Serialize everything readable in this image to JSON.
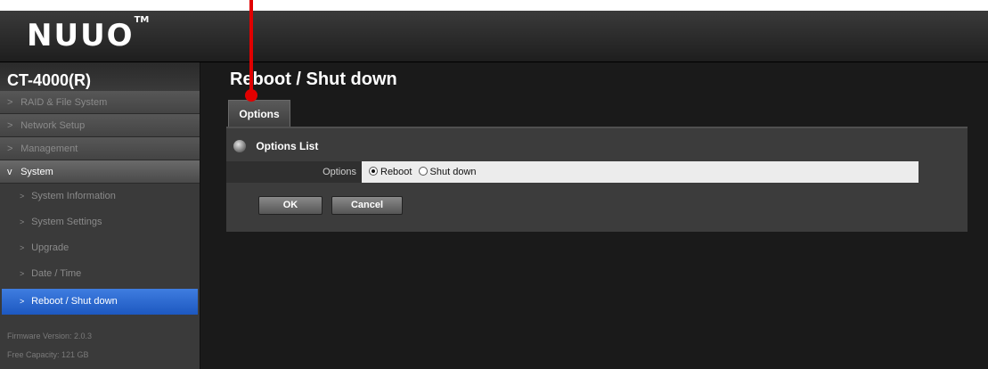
{
  "header": {
    "logo": "NUUO",
    "trademark": "TM"
  },
  "sidebar": {
    "device_name": "CT-4000(R)",
    "sections": [
      {
        "label": "RAID & File System",
        "chevron": ">"
      },
      {
        "label": "Network Setup",
        "chevron": ">"
      },
      {
        "label": "Management",
        "chevron": ">"
      },
      {
        "label": "System",
        "chevron": "v"
      }
    ],
    "sub_items": [
      {
        "label": "System Information"
      },
      {
        "label": "System Settings"
      },
      {
        "label": "Upgrade"
      },
      {
        "label": "Date / Time"
      },
      {
        "label": "Reboot / Shut down",
        "active": true
      }
    ],
    "firmware": "Firmware Version: 2.0.3",
    "capacity": "Free Capacity: 121 GB"
  },
  "main": {
    "title": "Reboot / Shut down",
    "tab_label": "Options",
    "panel_header": "Options List",
    "options_label": "Options",
    "radio_options": [
      {
        "label": "Reboot",
        "selected": true
      },
      {
        "label": "Shut down",
        "selected": false
      }
    ],
    "ok_label": "OK",
    "cancel_label": "Cancel"
  },
  "colors": {
    "accent": "#1d58c0",
    "annotation": "#e00000",
    "background": "#1a1a1a"
  },
  "icons": {
    "bullet": "options-list-bullet-icon",
    "chevron": "chevron-right-icon",
    "expanded": "chevron-down-icon"
  }
}
